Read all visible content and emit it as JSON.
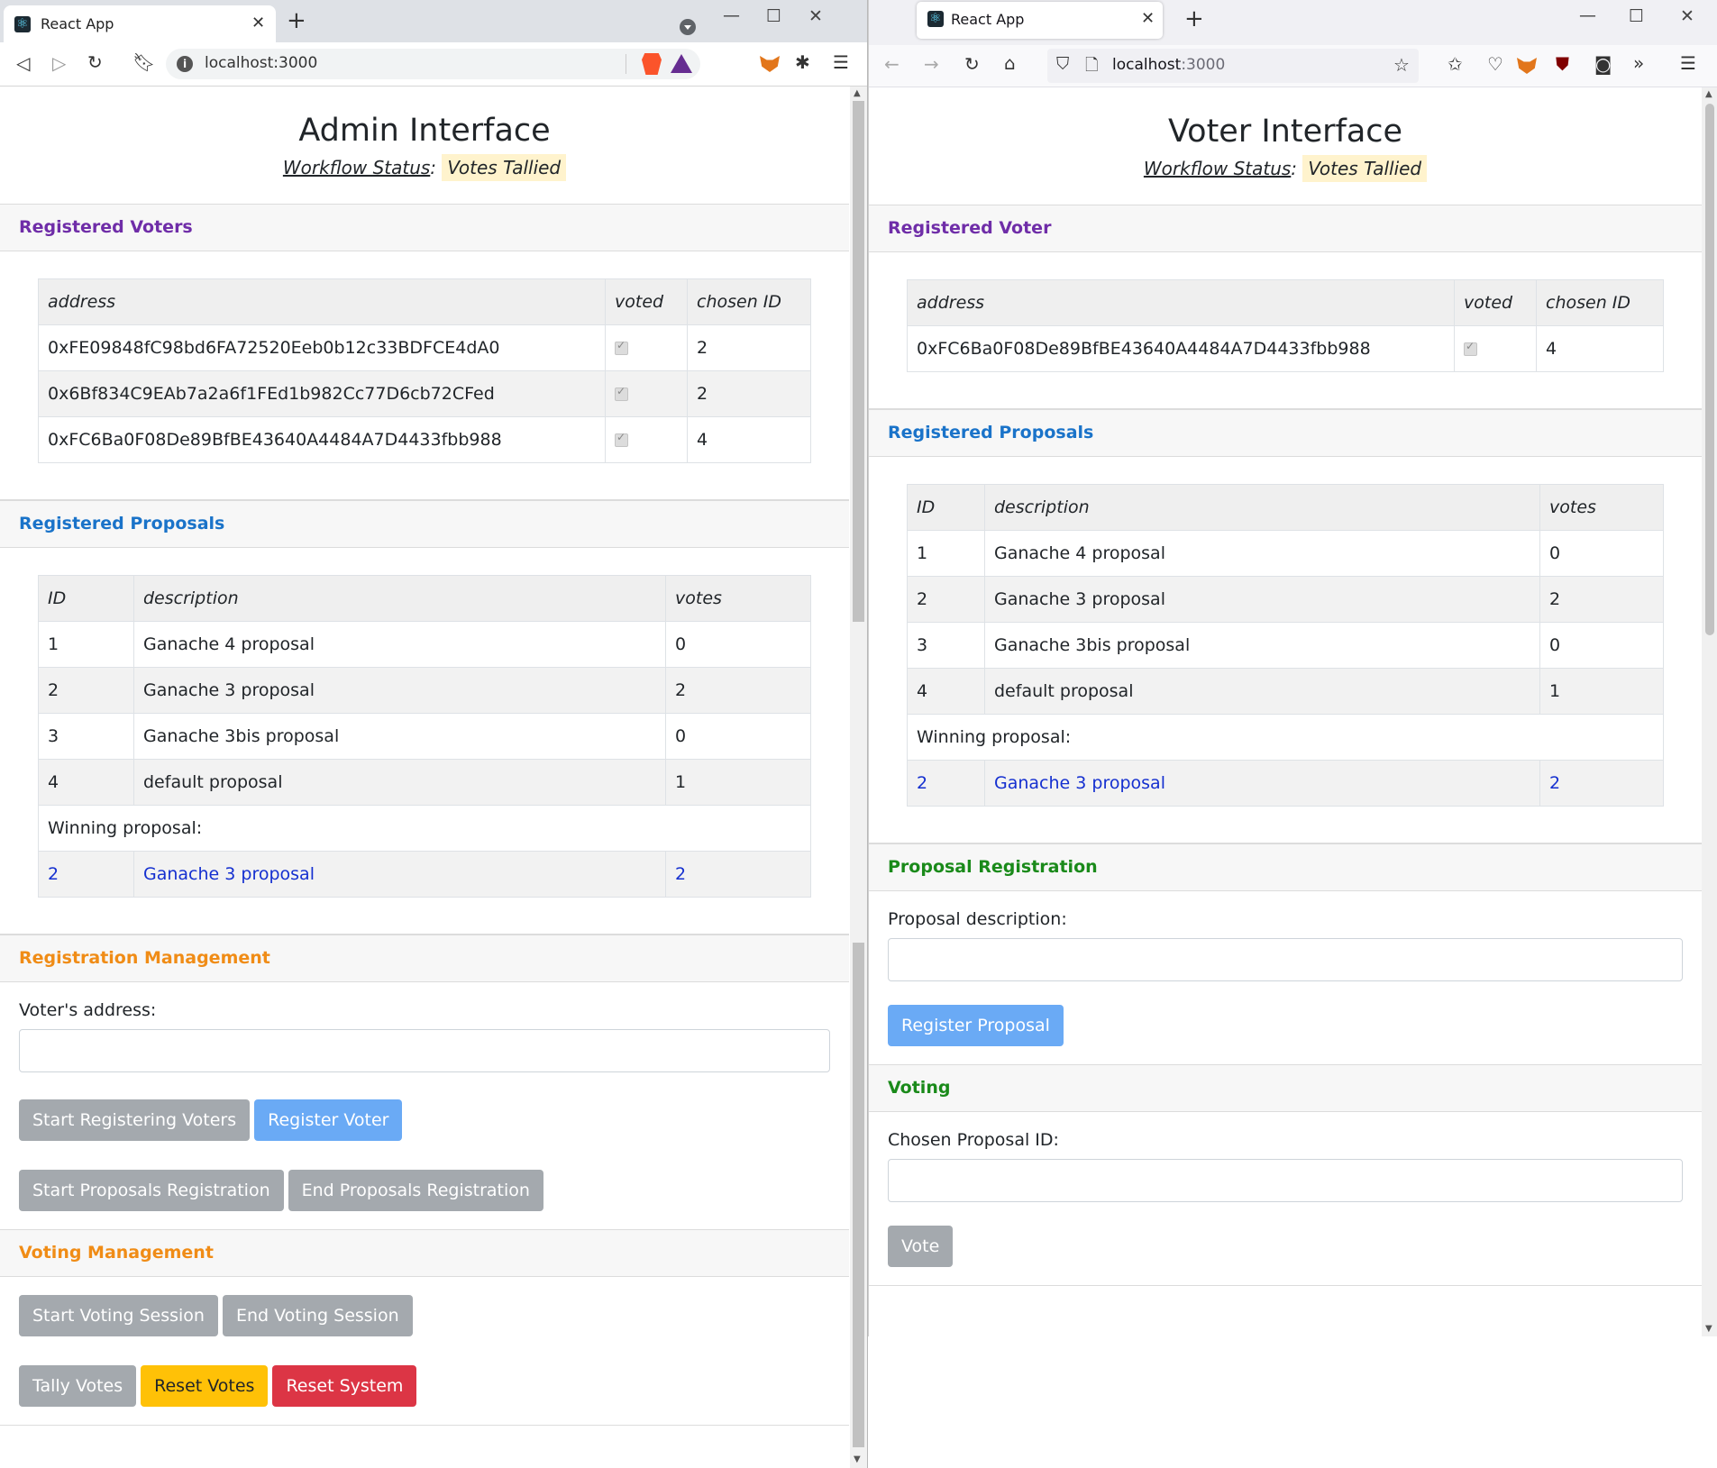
{
  "left": {
    "tab_title": "React App",
    "url": "localhost:3000",
    "page_title": "Admin Interface",
    "workflow_label": "Workflow Status",
    "workflow_value": "Votes Tallied",
    "voters_header": "Registered Voters",
    "voters_columns": [
      "address",
      "voted",
      "chosen ID"
    ],
    "voters": [
      {
        "address": "0xFE09848fC98bd6FA72520Eeb0b12c33BDFCE4dA0",
        "voted": true,
        "chosen_id": "2"
      },
      {
        "address": "0x6Bf834C9EAb7a2a6f1FEd1b982Cc77D6cb72CFed",
        "voted": true,
        "chosen_id": "2"
      },
      {
        "address": "0xFC6Ba0F08De89BfBE43640A4484A7D4433fbb988",
        "voted": true,
        "chosen_id": "4"
      }
    ],
    "proposals_header": "Registered Proposals",
    "proposals_columns": [
      "ID",
      "description",
      "votes"
    ],
    "proposals": [
      {
        "id": "1",
        "description": "Ganache 4 proposal",
        "votes": "0"
      },
      {
        "id": "2",
        "description": "Ganache 3 proposal",
        "votes": "2"
      },
      {
        "id": "3",
        "description": "Ganache 3bis proposal",
        "votes": "0"
      },
      {
        "id": "4",
        "description": "default proposal",
        "votes": "1"
      }
    ],
    "winning_label": "Winning proposal:",
    "winning": {
      "id": "2",
      "description": "Ganache 3 proposal",
      "votes": "2"
    },
    "registration_header": "Registration Management",
    "voter_address_label": "Voter's address:",
    "buttons": {
      "start_registering": "Start Registering Voters",
      "register_voter": "Register Voter",
      "start_proposals": "Start Proposals Registration",
      "end_proposals": "End Proposals Registration",
      "start_voting": "Start Voting Session",
      "end_voting": "End Voting Session",
      "tally": "Tally Votes",
      "reset_votes": "Reset Votes",
      "reset_system": "Reset System"
    },
    "voting_header": "Voting Management"
  },
  "right": {
    "tab_title": "React App",
    "url_host": "localhost",
    "url_port": ":3000",
    "page_title": "Voter Interface",
    "workflow_label": "Workflow Status",
    "workflow_value": "Votes Tallied",
    "voter_header": "Registered Voter",
    "voter_columns": [
      "address",
      "voted",
      "chosen ID"
    ],
    "voter": {
      "address": "0xFC6Ba0F08De89BfBE43640A4484A7D4433fbb988",
      "voted": true,
      "chosen_id": "4"
    },
    "proposals_header": "Registered Proposals",
    "proposals_columns": [
      "ID",
      "description",
      "votes"
    ],
    "proposals": [
      {
        "id": "1",
        "description": "Ganache 4 proposal",
        "votes": "0"
      },
      {
        "id": "2",
        "description": "Ganache 3 proposal",
        "votes": "2"
      },
      {
        "id": "3",
        "description": "Ganache 3bis proposal",
        "votes": "0"
      },
      {
        "id": "4",
        "description": "default proposal",
        "votes": "1"
      }
    ],
    "winning_label": "Winning proposal:",
    "winning": {
      "id": "2",
      "description": "Ganache 3 proposal",
      "votes": "2"
    },
    "proposal_reg_header": "Proposal Registration",
    "proposal_desc_label": "Proposal description:",
    "register_proposal_button": "Register Proposal",
    "voting_header": "Voting",
    "chosen_id_label": "Chosen Proposal ID:",
    "vote_button": "Vote"
  },
  "colors": {
    "purple_header": "#6f2da8",
    "blue_header": "#1a73c9",
    "orange_header": "#f08c16",
    "green_header": "#1a8a1a",
    "workflow_badge": "#fff3cd",
    "btn_grey": "#a4a9ae",
    "btn_blue": "#6aaaf5",
    "btn_yellow": "#ffc107",
    "btn_red": "#dc3545"
  },
  "icons": [
    "back-icon",
    "forward-icon",
    "reload-icon",
    "bookmark-icon",
    "info-icon",
    "brave-shield-icon",
    "brave-rewards-icon",
    "metamask-icon",
    "extensions-icon",
    "menu-icon",
    "home-icon",
    "tracking-shield-icon",
    "page-icon",
    "star-icon",
    "pocket-icon",
    "ublock-icon",
    "overflow-icon"
  ]
}
